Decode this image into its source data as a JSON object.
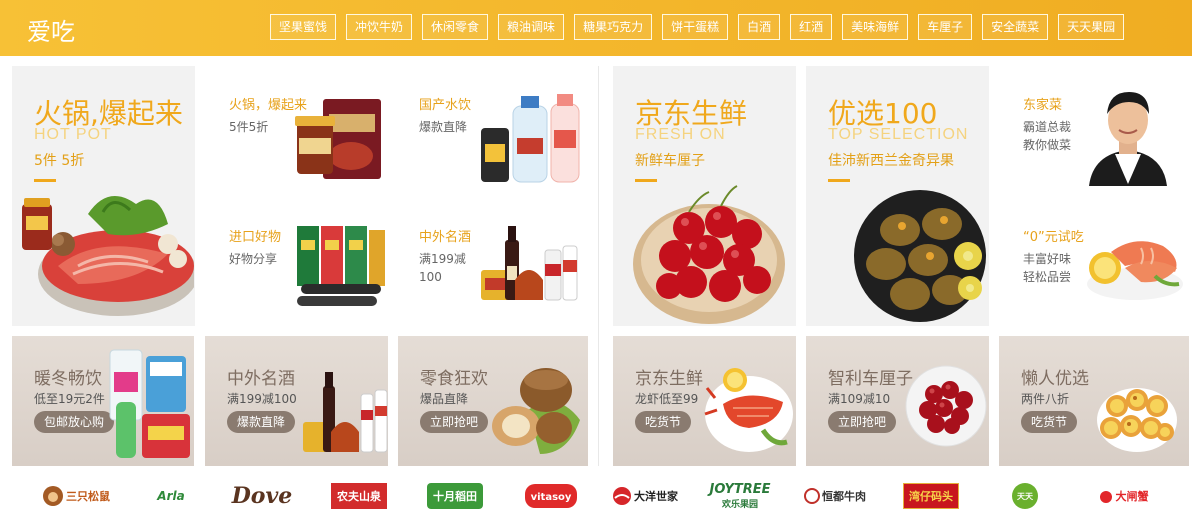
{
  "header": {
    "brand": "爱吃",
    "tags": [
      "坚果蜜饯",
      "冲饮牛奶",
      "休闲零食",
      "粮油调味",
      "糖果巧克力",
      "饼干蛋糕",
      "白酒",
      "红酒",
      "美味海鲜",
      "车厘子",
      "安全蔬菜",
      "天天果园"
    ]
  },
  "left": {
    "hero": {
      "title": "火锅,爆起来",
      "en": "HOT POT",
      "sub": "5件 5折"
    },
    "small": [
      {
        "title": "火锅，爆起来",
        "sub": "5件5折"
      },
      {
        "title": "国产水饮",
        "sub": "爆款直降"
      },
      {
        "title": "进口好物",
        "sub": "好物分享"
      },
      {
        "title": "中外名酒",
        "sub": "满199减",
        "sub2": "100"
      }
    ],
    "bottom": [
      {
        "title": "暖冬畅饮",
        "sub": "低至19元2件",
        "btn": "包邮放心购"
      },
      {
        "title": "中外名酒",
        "sub": "满199减100",
        "btn": "爆款直降"
      },
      {
        "title": "零食狂欢",
        "sub": "爆品直降",
        "btn": "立即抢吧"
      }
    ]
  },
  "right": {
    "fresh": {
      "title": "京东生鲜",
      "en": "FRESH ON",
      "sub": "新鲜车厘子"
    },
    "select": {
      "title": "优选100",
      "en": "TOP SELECTION",
      "sub": "佳沛新西兰金奇异果"
    },
    "small": [
      {
        "title": "东家菜",
        "sub": "霸道总裁",
        "sub2": "教你做菜"
      },
      {
        "title": "“0”元试吃",
        "sub": "丰富好味",
        "sub2": "轻松品尝"
      }
    ],
    "bottom": [
      {
        "title": "京东生鲜",
        "sub": "龙虾低至99",
        "btn": "吃货节"
      },
      {
        "title": "智利车厘子",
        "sub": "满109减10",
        "btn": "立即抢吧"
      },
      {
        "title": "懒人优选",
        "sub": "两件八折",
        "btn": "吃货节"
      }
    ]
  },
  "brands": [
    "三只松鼠",
    "Arla",
    "Dove",
    "农夫山泉",
    "十月稻田",
    "vitasoy",
    "大洋世家",
    "JOYTREE",
    "恒都牛肉",
    "湾仔码头",
    "天天果园",
    "大闸蟹"
  ],
  "brand_sub": {
    "joytree": "欢乐果园",
    "tiantian": "天天"
  },
  "colors": {
    "accent": "#f0a81c",
    "topbar": "#f3b52a",
    "button": "#8a7b70"
  }
}
